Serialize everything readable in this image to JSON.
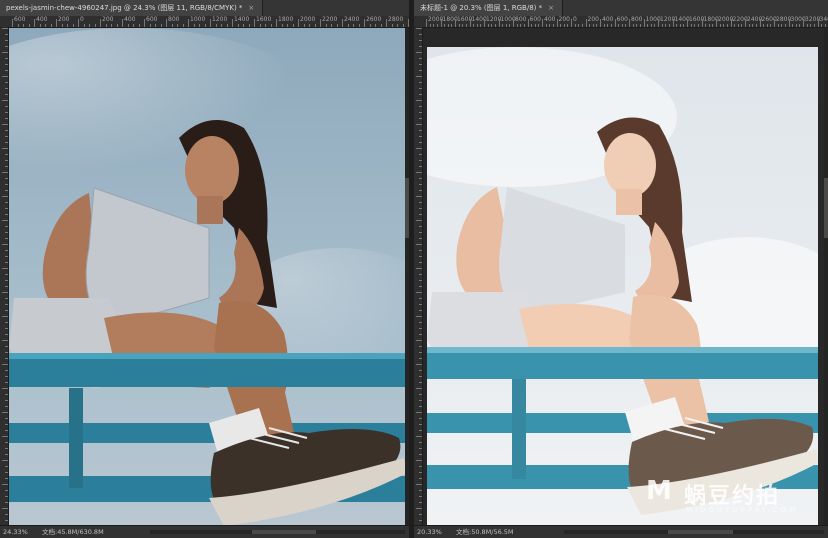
{
  "left_doc": {
    "tab_title": "pexels-jasmin-chew-4960247.jpg @ 24.3% (图层 11, RGB/8/CMYK) *",
    "close_glyph": "×",
    "ruler_labels": [
      "600",
      "400",
      "200",
      "0",
      "200",
      "400",
      "600",
      "800",
      "1000",
      "1200",
      "1400",
      "1600",
      "1800",
      "2000",
      "2200",
      "2400",
      "2600",
      "2800",
      "3000"
    ],
    "status_zoom": "24.33%",
    "status_info": "文档:45.8M/630.8M"
  },
  "right_doc": {
    "tab_title": "未标题-1 @ 20.3% (图层 1, RGB/8) *",
    "close_glyph": "×",
    "ruler_labels": [
      "2000",
      "1800",
      "1600",
      "1400",
      "1200",
      "1000",
      "800",
      "600",
      "400",
      "200",
      "0",
      "200",
      "400",
      "600",
      "800",
      "1000",
      "1200",
      "1400",
      "1600",
      "1800",
      "2000",
      "2200",
      "2400",
      "2600",
      "2800",
      "3000",
      "3200",
      "3400",
      "3600"
    ],
    "status_zoom": "20.33%",
    "status_info": "文档:50.8M/56.5M"
  },
  "watermark": {
    "logo": "M",
    "name": "蜗豆约拍",
    "sub": "MIDOUYUEPAI.COM"
  },
  "colors": {
    "panel_bg": "#282828",
    "sky_left": "#9fb6c6",
    "sky_right": "#e7ebef",
    "rail_teal": "#2b7f9a",
    "shoe_brown": "#3b3129"
  }
}
